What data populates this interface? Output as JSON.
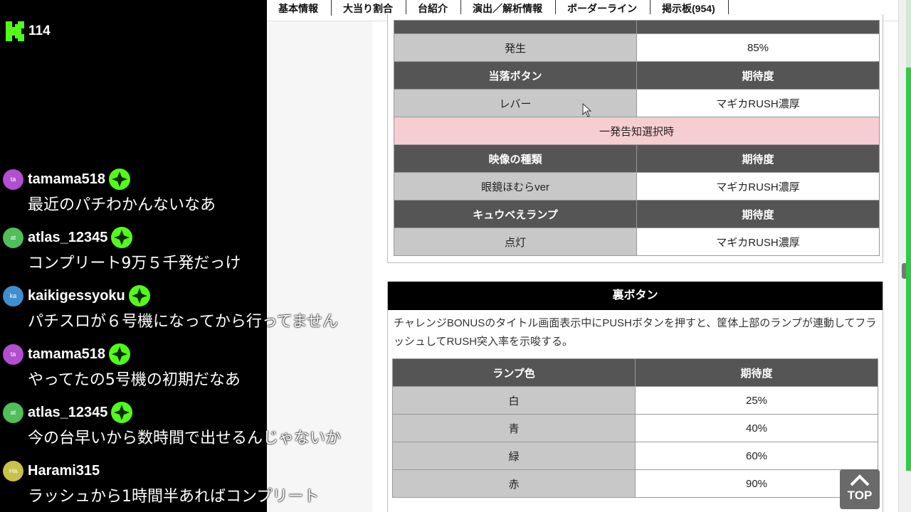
{
  "stream": {
    "viewer_count": "114",
    "comments": [
      {
        "avatar": "ta",
        "avatar_color": "#b14fcf",
        "user": "tamama518",
        "badge": true,
        "text": "最近のパチわかんないなあ"
      },
      {
        "avatar": "at",
        "avatar_color": "#4fbf5a",
        "user": "atlas_12345",
        "badge": true,
        "text": "コンプリート9万５千発だっけ"
      },
      {
        "avatar": "ka",
        "avatar_color": "#3f8fd0",
        "user": "kaikigessyoku",
        "badge": true,
        "text": "パチスロが６号機になってから行ってません"
      },
      {
        "avatar": "ta",
        "avatar_color": "#b14fcf",
        "user": "tamama518",
        "badge": true,
        "text": "やってたの5号機の初期だなあ"
      },
      {
        "avatar": "at",
        "avatar_color": "#4fbf5a",
        "user": "atlas_12345",
        "badge": true,
        "text": "今の台早いから数時間で出せるんじゃないか"
      },
      {
        "avatar": "Ha",
        "avatar_color": "#c8c24a",
        "user": "Harami315",
        "badge": false,
        "text": "ラッシュから1時間半あればコンプリート"
      }
    ]
  },
  "nav": {
    "tabs": [
      "基本情報",
      "大当り割合",
      "台紹介",
      "演出／解析情報",
      "ボーダーライン",
      "掲示板(954)"
    ]
  },
  "table1": {
    "rows": [
      {
        "type": "row",
        "label": "発生",
        "value": "85%"
      },
      {
        "type": "header",
        "label": "当落ボタン",
        "value": "期待度"
      },
      {
        "type": "row",
        "label": "レバー",
        "value": "マギカRUSH濃厚"
      },
      {
        "type": "pink",
        "label": "一発告知選択時"
      },
      {
        "type": "header",
        "label": "映像の種類",
        "value": "期待度"
      },
      {
        "type": "row",
        "label": "眼鏡ほむらver",
        "value": "マギカRUSH濃厚"
      },
      {
        "type": "header",
        "label": "キュウベえランプ",
        "value": "期待度"
      },
      {
        "type": "row",
        "label": "点灯",
        "value": "マギカRUSH濃厚"
      }
    ]
  },
  "ura": {
    "title": "裏ボタン",
    "description": "チャレンジBONUSのタイトル画面表示中にPUSHボタンを押すと、筐体上部のランプが連動してフラッシュしてRUSH突入率を示唆する。",
    "header": {
      "label": "ランプ色",
      "value": "期待度"
    },
    "rows": [
      {
        "label": "白",
        "value": "25%"
      },
      {
        "label": "青",
        "value": "40%"
      },
      {
        "label": "緑",
        "value": "60%"
      },
      {
        "label": "赤",
        "value": "90%"
      }
    ]
  },
  "top_button": {
    "label": "TOP"
  }
}
